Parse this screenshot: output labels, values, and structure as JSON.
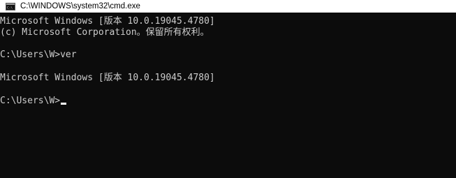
{
  "window": {
    "title": "C:\\WINDOWS\\system32\\cmd.exe",
    "icon": "cmd-console-icon"
  },
  "console": {
    "lines": [
      "Microsoft Windows [版本 10.0.19045.4780]",
      "(c) Microsoft Corporation。保留所有权利。",
      "C:\\Users\\W>ver",
      "Microsoft Windows [版本 10.0.19045.4780]",
      "C:\\Users\\W>"
    ]
  },
  "colors": {
    "background": "#0c0c0c",
    "text": "#cccccc",
    "titlebar": "#ffffff",
    "cursor": "#ffffff"
  }
}
